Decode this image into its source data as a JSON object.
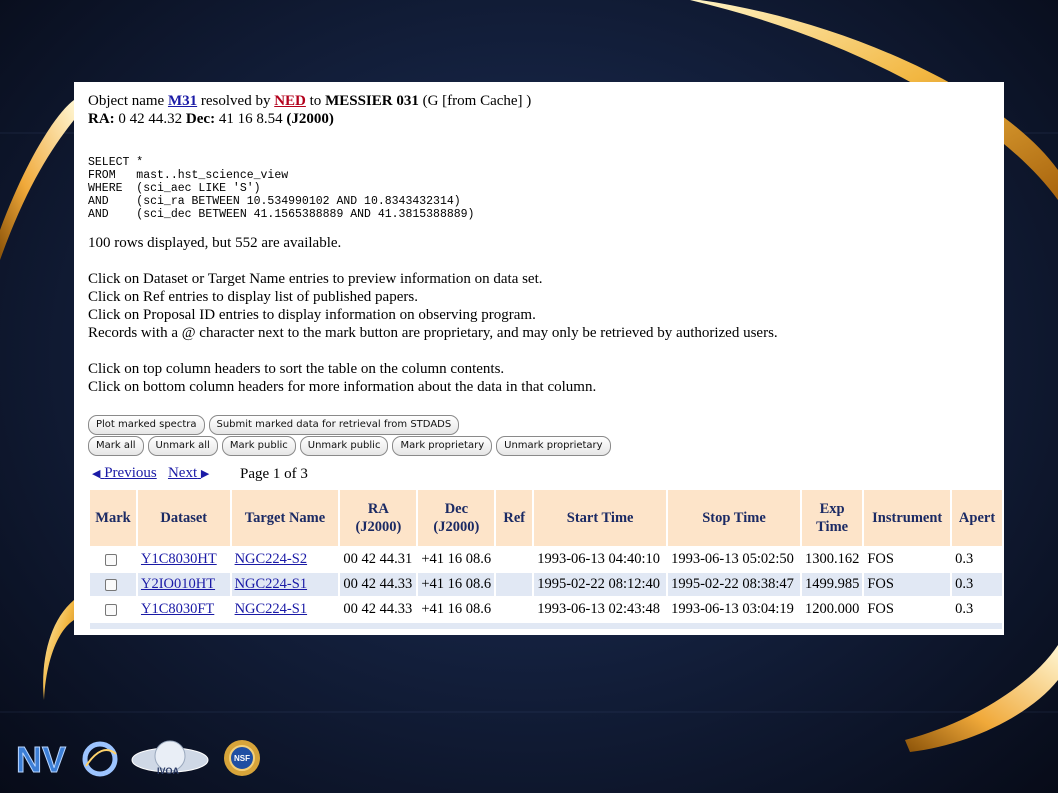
{
  "resolve": {
    "prefix": "Object name",
    "object": "M31",
    "middle": "resolved by",
    "service": "NED",
    "to": "to",
    "resolved_name": "MESSIER 031",
    "suffix": "(G [from Cache] )"
  },
  "coords": {
    "ra_label": "RA:",
    "ra": "0 42 44.32",
    "dec_label": "Dec:",
    "dec": "41 16 8.54",
    "epoch": "(J2000)"
  },
  "query": "SELECT *\nFROM   mast..hst_science_view\nWHERE  (sci_aec LIKE 'S')\nAND    (sci_ra BETWEEN 10.534990102 AND 10.8343432314)\nAND    (sci_dec BETWEEN 41.1565388889 AND 41.3815388889)",
  "rows_status": "100 rows displayed, but 552 are available.",
  "instructions": [
    "Click on Dataset or Target Name entries to preview information on data set.",
    "Click on Ref entries to display list of published papers.",
    "Click on Proposal ID entries to display information on observing program.",
    "Records with a @ character next to the mark button are proprietary, and may only be retrieved by authorized users."
  ],
  "sort_instructions": [
    "Click on top column headers to sort the table on the column contents.",
    "Click on bottom column headers for more information about the data in that column."
  ],
  "buttons_row1": [
    "Plot marked spectra",
    "Submit marked data for retrieval from STDADS"
  ],
  "buttons_row2": [
    "Mark all",
    "Unmark all",
    "Mark public",
    "Unmark public",
    "Mark proprietary",
    "Unmark proprietary"
  ],
  "pager": {
    "previous": "Previous",
    "next": "Next",
    "page_info": "Page 1 of 3"
  },
  "table": {
    "headers": [
      "Mark",
      "Dataset",
      "Target Name",
      "RA (J2000)",
      "Dec (J2000)",
      "Ref",
      "Start Time",
      "Stop Time",
      "Exp Time",
      "Instrument",
      "Apert"
    ],
    "rows": [
      [
        "Y1C8030HT",
        "NGC224-S2",
        "00 42 44.31",
        "+41 16 08.6",
        "",
        "1993-06-13 04:40:10",
        "1993-06-13 05:02:50",
        "1300.162",
        "FOS",
        "0.3"
      ],
      [
        "Y2IO010HT",
        "NGC224-S1",
        "00 42 44.33",
        "+41 16 08.6",
        "",
        "1995-02-22 08:12:40",
        "1995-02-22 08:38:47",
        "1499.985",
        "FOS",
        "0.3"
      ],
      [
        "Y1C8030FT",
        "NGC224-S1",
        "00 42 44.33",
        "+41 16 08.6",
        "",
        "1993-06-13 02:43:48",
        "1993-06-13 03:04:19",
        "1200.000",
        "FOS",
        "0.3"
      ]
    ]
  },
  "colors": {
    "header_bg": "#fde4c9",
    "alt_row_bg": "#e1e8f4",
    "link": "#1a1aa6",
    "ned_link": "#b3001b"
  },
  "footer_logos": [
    "NVO",
    "IVOA",
    "NSF"
  ]
}
